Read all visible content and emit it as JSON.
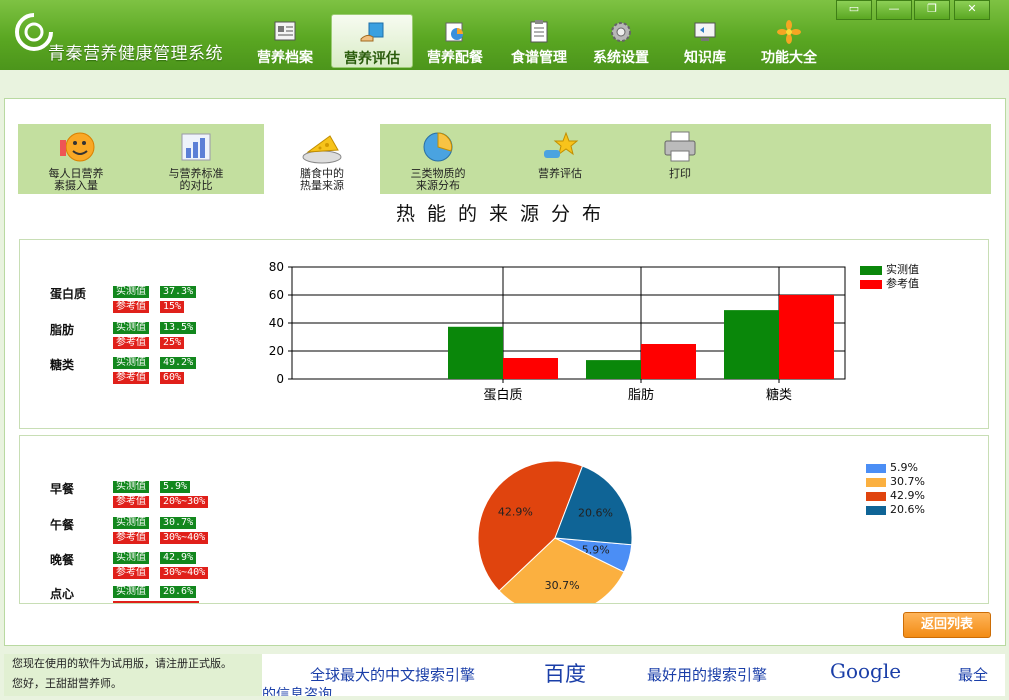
{
  "app": {
    "title": "青秦营养健康管理系统"
  },
  "nav": [
    {
      "label": "营养档案",
      "icon": "archive-icon"
    },
    {
      "label": "营养评估",
      "icon": "evaluation-icon",
      "active": true
    },
    {
      "label": "营养配餐",
      "icon": "meal-plan-icon"
    },
    {
      "label": "食谱管理",
      "icon": "recipe-icon"
    },
    {
      "label": "系统设置",
      "icon": "gear-icon"
    },
    {
      "label": "知识库",
      "icon": "knowledge-icon"
    },
    {
      "label": "功能大全",
      "icon": "flower-icon"
    }
  ],
  "window_controls": [
    "▭",
    "—",
    "❐",
    "✕"
  ],
  "tabs": [
    {
      "label": "每人日营养\n素摄入量",
      "icon": "smiley-icon"
    },
    {
      "label": "与营养标准\n的对比",
      "icon": "bar-chart-icon"
    },
    {
      "label": "膳食中的\n热量来源",
      "icon": "cheese-icon",
      "active": true
    },
    {
      "label": "三类物质的\n来源分布",
      "icon": "pie-icon"
    },
    {
      "label": "营养评估",
      "icon": "star-hand-icon"
    },
    {
      "label": "打印",
      "icon": "printer-icon"
    }
  ],
  "section_title": "热能的来源分布",
  "nutrients": [
    {
      "name": "蛋白质",
      "measured_label": "实测值",
      "measured": "37.3%",
      "reference_label": "参考值",
      "reference": "15%"
    },
    {
      "name": "脂肪",
      "measured_label": "实测值",
      "measured": "13.5%",
      "reference_label": "参考值",
      "reference": "25%"
    },
    {
      "name": "糖类",
      "measured_label": "实测值",
      "measured": "49.2%",
      "reference_label": "参考值",
      "reference": "60%"
    }
  ],
  "meals": [
    {
      "name": "早餐",
      "measured_label": "实测值",
      "measured": "5.9%",
      "reference_label": "参考值",
      "reference": "20%~30%"
    },
    {
      "name": "午餐",
      "measured_label": "实测值",
      "measured": "30.7%",
      "reference_label": "参考值",
      "reference": "30%~40%"
    },
    {
      "name": "晚餐",
      "measured_label": "实测值",
      "measured": "42.9%",
      "reference_label": "参考值",
      "reference": "30%~40%"
    },
    {
      "name": "点心",
      "measured_label": "实测值",
      "measured": "20.6%"
    }
  ],
  "chart_data": [
    {
      "type": "bar",
      "categories": [
        "蛋白质",
        "脂肪",
        "糖类"
      ],
      "series": [
        {
          "name": "实测值",
          "values": [
            37.3,
            13.5,
            49.2
          ],
          "color": "#0a870a"
        },
        {
          "name": "参考值",
          "values": [
            15,
            25,
            60
          ],
          "color": "#ff0000"
        }
      ],
      "ylim": [
        0,
        80
      ],
      "yticks": [
        0,
        20,
        40,
        60,
        80
      ],
      "grid": true,
      "legend": "right"
    },
    {
      "type": "pie",
      "slices": [
        {
          "label": "5.9%",
          "value": 5.9,
          "color": "#4b8ef5"
        },
        {
          "label": "30.7%",
          "value": 30.7,
          "color": "#fbb040"
        },
        {
          "label": "42.9%",
          "value": 42.9,
          "color": "#e0440e"
        },
        {
          "label": "20.6%",
          "value": 20.6,
          "color": "#0f6496"
        }
      ],
      "legend": "right"
    }
  ],
  "back_button": "返回列表",
  "status": {
    "line1": "您现在使用的软件为试用版，请注册正式版。",
    "line2": "您好，王甜甜营养师。"
  },
  "ticker": {
    "t1": "全球最大的中文搜索引擎",
    "t2": "百度",
    "t3": "最好用的搜索引擎",
    "t4": "Google",
    "t5": "最全",
    "t6": "的信息咨询"
  }
}
